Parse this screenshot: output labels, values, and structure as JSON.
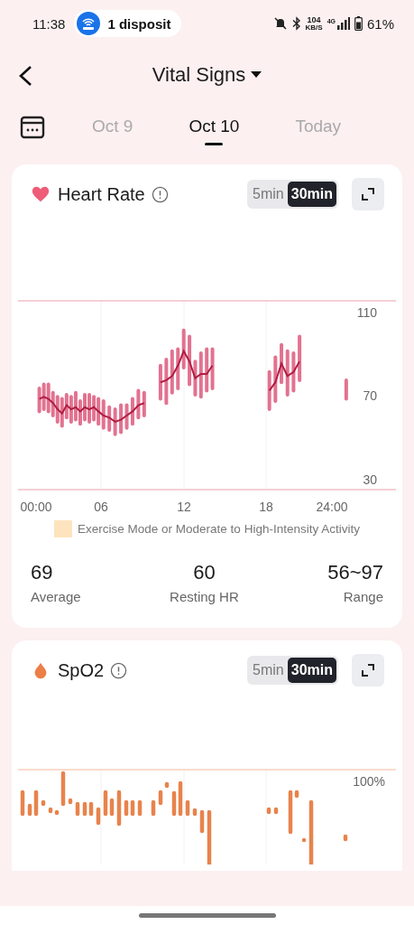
{
  "status_bar": {
    "time": "11:38",
    "notification": "1 disposit",
    "speed": "104",
    "speed_unit": "KB/S",
    "network": "4G",
    "battery": "61%"
  },
  "header": {
    "title": "Vital Signs"
  },
  "date_tabs": [
    {
      "label": "Oct 9",
      "selected": false
    },
    {
      "label": "Oct 10",
      "selected": true
    },
    {
      "label": "Today",
      "selected": false
    }
  ],
  "cards": [
    {
      "kind": "heart",
      "title": "Heart Rate",
      "intervals": [
        {
          "label": "5min",
          "selected": false
        },
        {
          "label": "30min",
          "selected": true
        }
      ],
      "y_labels": [
        "110",
        "70",
        "30"
      ],
      "x_labels": [
        "00:00",
        "06",
        "12",
        "18",
        "24:00"
      ],
      "legend": "Exercise Mode or Moderate to High-Intensity Activity",
      "stats": [
        {
          "value": "69",
          "label": "Average"
        },
        {
          "value": "60",
          "label": "Resting HR"
        },
        {
          "value": "56~97",
          "label": "Range"
        }
      ]
    },
    {
      "kind": "spo2",
      "title": "SpO2",
      "intervals": [
        {
          "label": "5min",
          "selected": false
        },
        {
          "label": "30min",
          "selected": true
        }
      ],
      "y_labels": [
        "100%"
      ]
    }
  ]
}
